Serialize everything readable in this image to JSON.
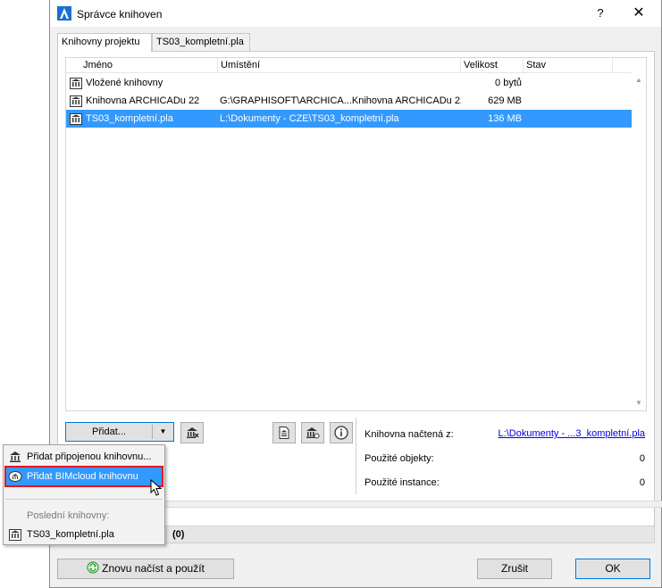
{
  "window": {
    "title": "Správce knihoven",
    "help_label": "?",
    "close_label": "✕"
  },
  "tabs": [
    {
      "label": "Knihovny projektu",
      "active": true
    },
    {
      "label": "TS03_kompletní.pla",
      "active": false
    }
  ],
  "table": {
    "columns": [
      "Jméno",
      "Umístění",
      "Velikost",
      "Stav"
    ],
    "rows": [
      {
        "name": "Vložené knihovny",
        "location": "",
        "size": "0 bytů",
        "status": "",
        "icon": "embedded-library-icon"
      },
      {
        "name": "Knihovna ARCHICADu 22",
        "location": "G:\\GRAPHISOFT\\ARCHICA...Knihovna ARCHICADu 22",
        "size": "629 MB",
        "status": "",
        "icon": "library-icon"
      },
      {
        "name": "TS03_kompletní.pla",
        "location": "L:\\Dokumenty - CZE\\TS03_kompletní.pla",
        "size": "136 MB",
        "status": "",
        "icon": "library-icon",
        "selected": true
      }
    ]
  },
  "toolbar": {
    "add_label": "Přidat...",
    "add_arrow": "▼"
  },
  "info": {
    "loaded_from_label": "Knihovna načtená z:",
    "loaded_from_value": "L:\\Dokumenty - ...3_kompletní.pla",
    "used_objects_label": "Použité objekty:",
    "used_objects_value": "0",
    "used_instances_label": "Použité instance:",
    "used_instances_value": "0"
  },
  "status": {
    "count_text": "(0)"
  },
  "footer": {
    "reload_label": "Znovu načíst a použít",
    "cancel_label": "Zrušit",
    "ok_label": "OK"
  },
  "menu": {
    "items": [
      {
        "label": "Přidat připojenou knihovnu..."
      },
      {
        "label": "Přidat BIMcloud knihovnu",
        "highlighted": true
      }
    ],
    "recent_caption": "Poslední knihovny:",
    "recent_items": [
      {
        "label": "TS03_kompletní.pla"
      }
    ]
  },
  "colors": {
    "selection": "#3399ff",
    "highlight_outline": "#e81123",
    "link": "#0000ee"
  }
}
